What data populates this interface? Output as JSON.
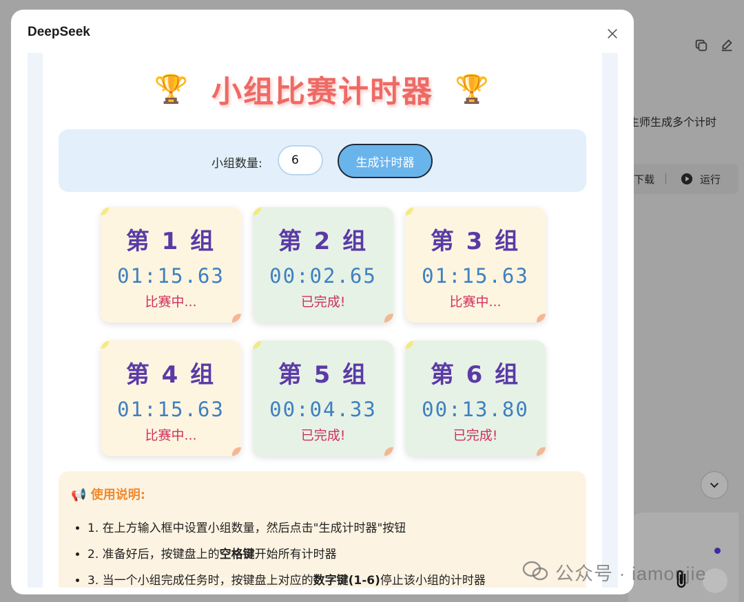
{
  "background": {
    "partial_text": "生师生成多个计时",
    "toolbar": {
      "download": "下载",
      "run": "运行"
    }
  },
  "modal": {
    "title": "DeepSeek",
    "app": {
      "title": "小组比赛计时器",
      "controls": {
        "label": "小组数量:",
        "count_value": "6",
        "generate_label": "生成计时器"
      },
      "groups": [
        {
          "name": "第 1 组",
          "time": "01:15.63",
          "status": "比赛中...",
          "state": "running"
        },
        {
          "name": "第 2 组",
          "time": "00:02.65",
          "status": "已完成!",
          "state": "done"
        },
        {
          "name": "第 3 组",
          "time": "01:15.63",
          "status": "比赛中...",
          "state": "running"
        },
        {
          "name": "第 4 组",
          "time": "01:15.63",
          "status": "比赛中...",
          "state": "running"
        },
        {
          "name": "第 5 组",
          "time": "00:04.33",
          "status": "已完成!",
          "state": "done"
        },
        {
          "name": "第 6 组",
          "time": "00:13.80",
          "status": "已完成!",
          "state": "done"
        }
      ],
      "instructions": {
        "title": "使用说明:",
        "items": [
          {
            "pre": "1. 在上方输入框中设置小组数量，然后点击\"生成计时器\"按钮",
            "bold": "",
            "post": ""
          },
          {
            "pre": "2. 准备好后，按键盘上的",
            "bold": "空格键",
            "post": "开始所有计时器"
          },
          {
            "pre": "3. 当一个小组完成任务时，按键盘上对应的",
            "bold": "数字键(1-6)",
            "post": "停止该小组的计时器"
          }
        ]
      }
    }
  },
  "watermark": "公众号 · iamoujie",
  "colors": {
    "title": "#ee6a64",
    "group_name": "#5b3aa6",
    "timer": "#3f7fc0",
    "status": "#cf2f5b",
    "running_card": "#fdf5e0",
    "done_card": "#e6f2e6",
    "button": "#6ab4ec",
    "instructions_title": "#ef8a2e"
  }
}
